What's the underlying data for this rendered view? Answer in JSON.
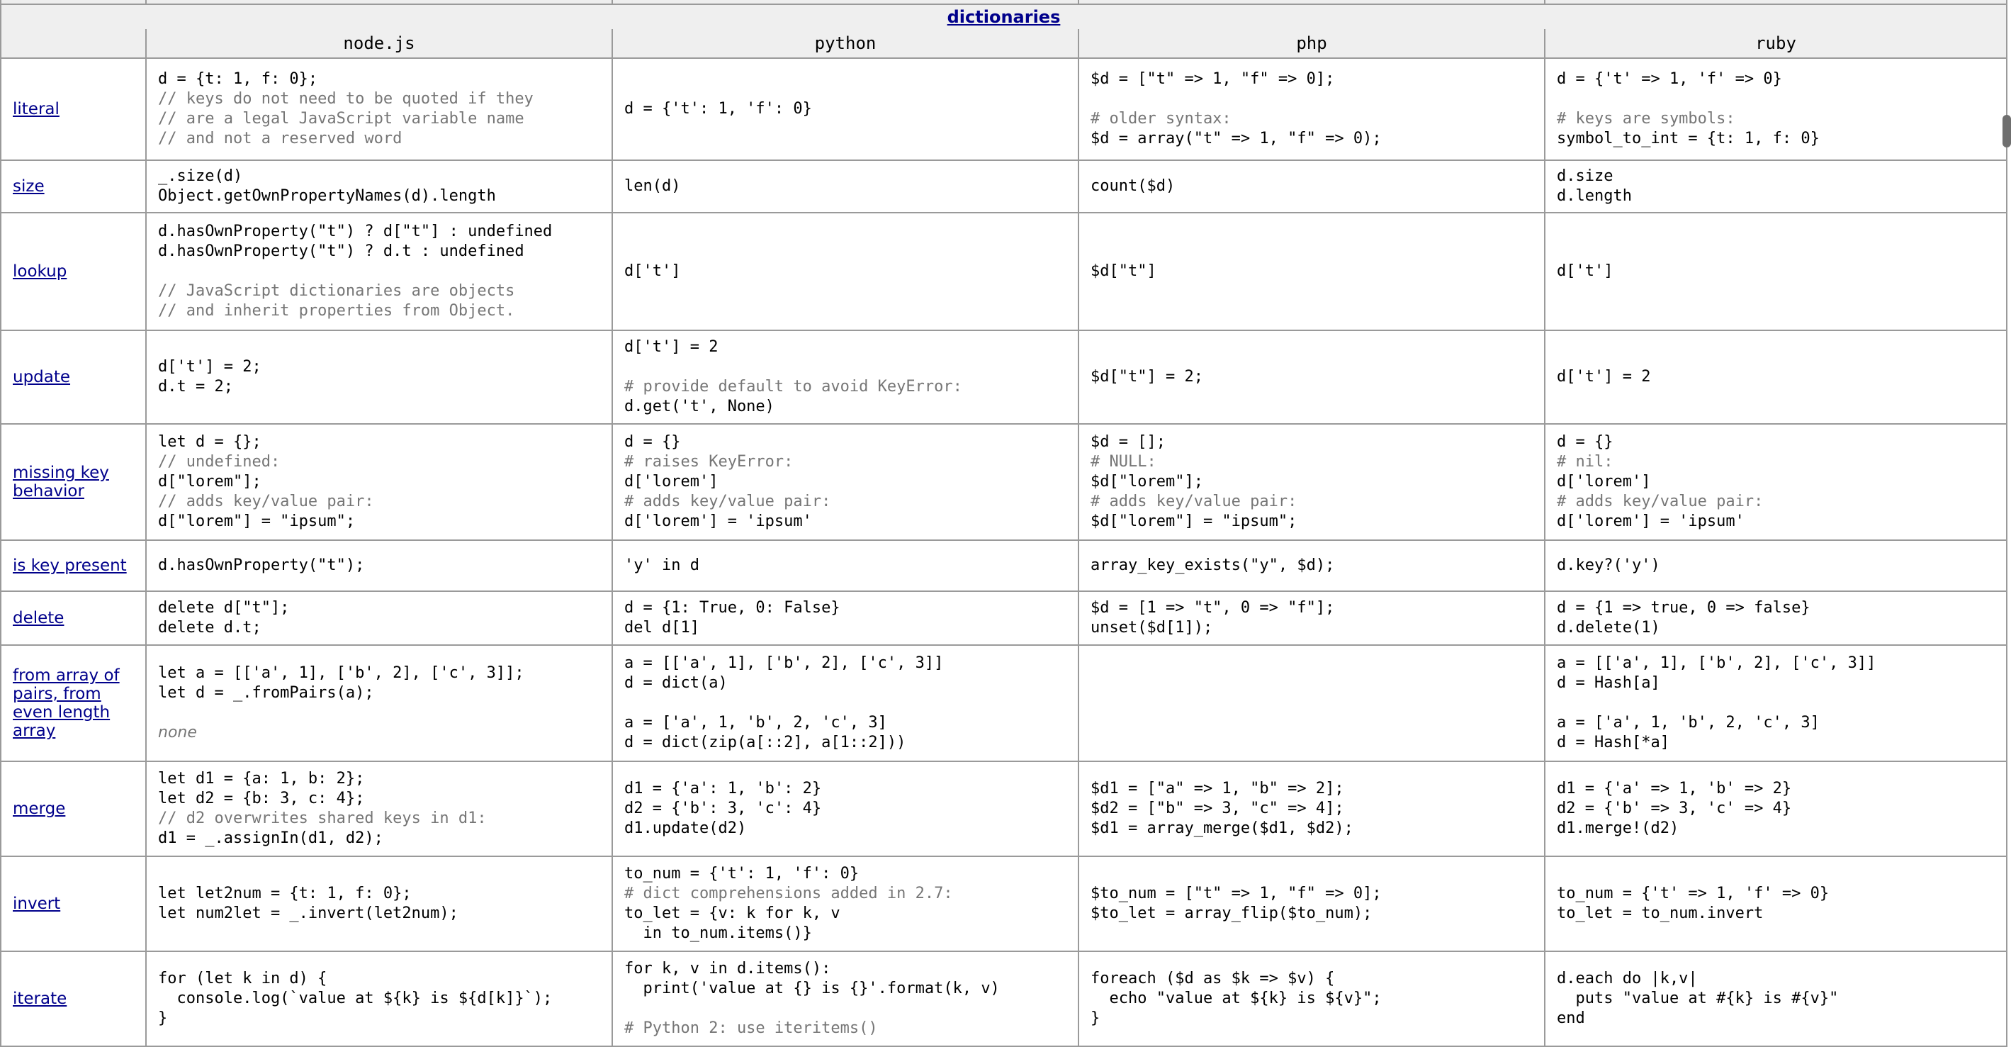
{
  "section": {
    "title": "dictionaries"
  },
  "languages": [
    "node.js",
    "python",
    "php",
    "ruby"
  ],
  "rows": [
    {
      "feature": "literal",
      "cells": [
        [
          {
            "t": "d = {t: 1, f: 0};"
          },
          {
            "t": "// keys do not need to be quoted if they",
            "c": 1
          },
          {
            "t": "// are a legal JavaScript variable name",
            "c": 1
          },
          {
            "t": "// and not a reserved word",
            "c": 1
          }
        ],
        [
          {
            "t": "d = {'t': 1, 'f': 0}"
          }
        ],
        [
          {
            "t": "$d = [\"t\" => 1, \"f\" => 0];"
          },
          {
            "t": ""
          },
          {
            "t": "# older syntax:",
            "c": 1
          },
          {
            "t": "$d = array(\"t\" => 1, \"f\" => 0);"
          }
        ],
        [
          {
            "t": "d = {'t' => 1, 'f' => 0}"
          },
          {
            "t": ""
          },
          {
            "t": "# keys are symbols:",
            "c": 1
          },
          {
            "t": "symbol_to_int = {t: 1, f: 0}"
          }
        ]
      ]
    },
    {
      "feature": "size",
      "cells": [
        [
          {
            "t": "_.size(d)"
          },
          {
            "t": "Object.getOwnPropertyNames(d).length"
          }
        ],
        [
          {
            "t": "len(d)"
          }
        ],
        [
          {
            "t": "count($d)"
          }
        ],
        [
          {
            "t": "d.size"
          },
          {
            "t": "d.length"
          }
        ]
      ]
    },
    {
      "feature": "lookup",
      "cells": [
        [
          {
            "t": "d.hasOwnProperty(\"t\") ? d[\"t\"] : undefined"
          },
          {
            "t": "d.hasOwnProperty(\"t\") ? d.t : undefined"
          },
          {
            "t": ""
          },
          {
            "t": "// JavaScript dictionaries are objects",
            "c": 1
          },
          {
            "t": "// and inherit properties from Object.",
            "c": 1
          }
        ],
        [
          {
            "t": "d['t']"
          }
        ],
        [
          {
            "t": "$d[\"t\"]"
          }
        ],
        [
          {
            "t": "d['t']"
          }
        ]
      ]
    },
    {
      "feature": "update",
      "cells": [
        [
          {
            "t": "d['t'] = 2;"
          },
          {
            "t": "d.t = 2;"
          }
        ],
        [
          {
            "t": "d['t'] = 2"
          },
          {
            "t": ""
          },
          {
            "t": "# provide default to avoid KeyError:",
            "c": 1
          },
          {
            "t": "d.get('t', None)"
          }
        ],
        [
          {
            "t": "$d[\"t\"] = 2;"
          }
        ],
        [
          {
            "t": "d['t'] = 2"
          }
        ]
      ]
    },
    {
      "feature": "missing key behavior",
      "cells": [
        [
          {
            "t": "let d = {};"
          },
          {
            "t": "// undefined:",
            "c": 1
          },
          {
            "t": "d[\"lorem\"];"
          },
          {
            "t": "// adds key/value pair:",
            "c": 1
          },
          {
            "t": "d[\"lorem\"] = \"ipsum\";"
          }
        ],
        [
          {
            "t": "d = {}"
          },
          {
            "t": "# raises KeyError:",
            "c": 1
          },
          {
            "t": "d['lorem']"
          },
          {
            "t": "# adds key/value pair:",
            "c": 1
          },
          {
            "t": "d['lorem'] = 'ipsum'"
          }
        ],
        [
          {
            "t": "$d = [];"
          },
          {
            "t": "# NULL:",
            "c": 1
          },
          {
            "t": "$d[\"lorem\"];"
          },
          {
            "t": "# adds key/value pair:",
            "c": 1
          },
          {
            "t": "$d[\"lorem\"] = \"ipsum\";"
          }
        ],
        [
          {
            "t": "d = {}"
          },
          {
            "t": "# nil:",
            "c": 1
          },
          {
            "t": "d['lorem']"
          },
          {
            "t": "# adds key/value pair:",
            "c": 1
          },
          {
            "t": "d['lorem'] = 'ipsum'"
          }
        ]
      ]
    },
    {
      "feature": "is key present",
      "cells": [
        [
          {
            "t": "d.hasOwnProperty(\"t\");"
          }
        ],
        [
          {
            "t": "'y' in d"
          }
        ],
        [
          {
            "t": "array_key_exists(\"y\", $d);"
          }
        ],
        [
          {
            "t": "d.key?('y')"
          }
        ]
      ]
    },
    {
      "feature": "delete",
      "cells": [
        [
          {
            "t": "delete d[\"t\"];"
          },
          {
            "t": "delete d.t;"
          }
        ],
        [
          {
            "t": "d = {1: True, 0: False}"
          },
          {
            "t": "del d[1]"
          }
        ],
        [
          {
            "t": "$d = [1 => \"t\", 0 => \"f\"];"
          },
          {
            "t": "unset($d[1]);"
          }
        ],
        [
          {
            "t": "d = {1 => true, 0 => false}"
          },
          {
            "t": "d.delete(1)"
          }
        ]
      ]
    },
    {
      "feature": "from array of pairs, from even length array",
      "cells": [
        [
          {
            "t": "let a = [['a', 1], ['b', 2], ['c', 3]];"
          },
          {
            "t": "let d = _.fromPairs(a);"
          },
          {
            "t": ""
          },
          {
            "t": "none",
            "i": 1
          }
        ],
        [
          {
            "t": "a = [['a', 1], ['b', 2], ['c', 3]]"
          },
          {
            "t": "d = dict(a)"
          },
          {
            "t": ""
          },
          {
            "t": "a = ['a', 1, 'b', 2, 'c', 3]"
          },
          {
            "t": "d = dict(zip(a[::2], a[1::2]))"
          }
        ],
        [],
        [
          {
            "t": "a = [['a', 1], ['b', 2], ['c', 3]]"
          },
          {
            "t": "d = Hash[a]"
          },
          {
            "t": ""
          },
          {
            "t": "a = ['a', 1, 'b', 2, 'c', 3]"
          },
          {
            "t": "d = Hash[*a]"
          }
        ]
      ]
    },
    {
      "feature": "merge",
      "cells": [
        [
          {
            "t": "let d1 = {a: 1, b: 2};"
          },
          {
            "t": "let d2 = {b: 3, c: 4};"
          },
          {
            "t": "// d2 overwrites shared keys in d1:",
            "c": 1
          },
          {
            "t": "d1 = _.assignIn(d1, d2);"
          }
        ],
        [
          {
            "t": "d1 = {'a': 1, 'b': 2}"
          },
          {
            "t": "d2 = {'b': 3, 'c': 4}"
          },
          {
            "t": "d1.update(d2)"
          }
        ],
        [
          {
            "t": "$d1 = [\"a\" => 1, \"b\" => 2];"
          },
          {
            "t": "$d2 = [\"b\" => 3, \"c\" => 4];"
          },
          {
            "t": "$d1 = array_merge($d1, $d2);"
          }
        ],
        [
          {
            "t": "d1 = {'a' => 1, 'b' => 2}"
          },
          {
            "t": "d2 = {'b' => 3, 'c' => 4}"
          },
          {
            "t": "d1.merge!(d2)"
          }
        ]
      ]
    },
    {
      "feature": "invert",
      "cells": [
        [
          {
            "t": "let let2num = {t: 1, f: 0};"
          },
          {
            "t": "let num2let = _.invert(let2num);"
          }
        ],
        [
          {
            "t": "to_num = {'t': 1, 'f': 0}"
          },
          {
            "t": "# dict comprehensions added in 2.7:",
            "c": 1
          },
          {
            "t": "to_let = {v: k for k, v"
          },
          {
            "t": "  in to_num.items()}"
          }
        ],
        [
          {
            "t": "$to_num = [\"t\" => 1, \"f\" => 0];"
          },
          {
            "t": "$to_let = array_flip($to_num);"
          }
        ],
        [
          {
            "t": "to_num = {'t' => 1, 'f' => 0}"
          },
          {
            "t": "to_let = to_num.invert"
          }
        ]
      ]
    },
    {
      "feature": "iterate",
      "cells": [
        [
          {
            "t": "for (let k in d) {"
          },
          {
            "t": "  console.log(`value at ${k} is ${d[k]}`);"
          },
          {
            "t": "}"
          }
        ],
        [
          {
            "t": "for k, v in d.items():"
          },
          {
            "t": "  print('value at {} is {}'.format(k, v)"
          },
          {
            "t": ""
          },
          {
            "t": "# Python 2: use iteritems()",
            "c": 1
          }
        ],
        [
          {
            "t": "foreach ($d as $k => $v) {"
          },
          {
            "t": "  echo \"value at ${k} is ${v}\";"
          },
          {
            "t": "}"
          }
        ],
        [
          {
            "t": "d.each do |k,v|"
          },
          {
            "t": "  puts \"value at #{k} is #{v}\""
          },
          {
            "t": "end"
          }
        ]
      ]
    }
  ]
}
